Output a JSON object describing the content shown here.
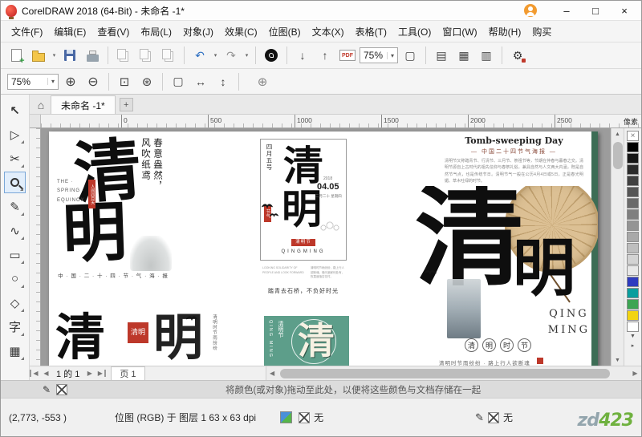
{
  "window": {
    "title": "CorelDRAW 2018 (64-Bit) - 未命名 -1*"
  },
  "icons": {
    "minimize": "–",
    "maximize": "□",
    "close": "×",
    "dropdown": "▾",
    "undo": "↶",
    "redo": "↷",
    "import": "↓",
    "export": "↑",
    "fullscreen": "▢",
    "rulers": "▤",
    "grid": "▦",
    "guides": "▥",
    "options": "⚙",
    "zoom_in": "⊕",
    "zoom_out": "⊖",
    "zoom_sel": "⊡",
    "zoom_all": "⊛",
    "zoom_page": "▢",
    "zoom_width": "↔",
    "zoom_height": "↕",
    "add_plus": "⊕",
    "home": "⌂",
    "tab_add": "+",
    "nav_first": "◀",
    "nav_prev": "◀",
    "nav_next": "▶",
    "nav_last": "▶",
    "scroll_left": "◀",
    "scroll_right": "▶",
    "scroll_up": "▲",
    "scroll_down": "▼",
    "none_x": "×",
    "pen": "✎",
    "flyout": "▸"
  },
  "menu": {
    "items": [
      "文件(F)",
      "编辑(E)",
      "查看(V)",
      "布局(L)",
      "对象(J)",
      "效果(C)",
      "位图(B)",
      "文本(X)",
      "表格(T)",
      "工具(O)",
      "窗口(W)",
      "帮助(H)",
      "购买"
    ]
  },
  "toolbar": {
    "zoom_value": "75%",
    "pdf_label": "PDF"
  },
  "propbar": {
    "zoom_value": "75%"
  },
  "doctabs": {
    "active": "未命名 -1*"
  },
  "ruler": {
    "ticks": [
      "0",
      "500",
      "1000",
      "1500",
      "2000",
      "2500"
    ],
    "unit": "像素"
  },
  "toolbox": {
    "tools": [
      {
        "name": "pick",
        "glyph": "↖"
      },
      {
        "name": "shape",
        "glyph": "▷"
      },
      {
        "name": "crop",
        "glyph": "✂"
      },
      {
        "name": "zoom",
        "glyph": ""
      },
      {
        "name": "freehand",
        "glyph": "✎"
      },
      {
        "name": "artistic-media",
        "glyph": "∿"
      },
      {
        "name": "rectangle",
        "glyph": "▭"
      },
      {
        "name": "ellipse",
        "glyph": "○"
      },
      {
        "name": "polygon",
        "glyph": "◇"
      },
      {
        "name": "text",
        "glyph": "字"
      },
      {
        "name": "table",
        "glyph": "▦"
      }
    ]
  },
  "palette": {
    "colors": [
      "#000000",
      "#161616",
      "#2b2b2b",
      "#404040",
      "#555555",
      "#6a6a6a",
      "#7f7f7f",
      "#949494",
      "#a9a9a9",
      "#bebebe",
      "#d3d3d3",
      "#e8e8e8",
      "#2e3bbf",
      "#0b9e9e",
      "#3da553",
      "#f2d411",
      "#ffffff"
    ]
  },
  "canvas": {
    "p1": {
      "line1": "春意盎然，",
      "line2": "风吹纸鸢",
      "big1": "清",
      "big2": "明",
      "en1": "THE ·",
      "en2": "SPRING ·",
      "en3": "EQUINOX",
      "seal": "人间四月天",
      "footer": "中 · 国 · 二 · 十 · 四 · 节 · 气 · 海 · 报"
    },
    "p2": {
      "corner": "四月五号",
      "big1": "清",
      "big2": "明",
      "seal": "节气",
      "year": "2018",
      "date": "04.05",
      "weekday": "二月二十 星期四",
      "festival": "清明节",
      "en": "QINGMING",
      "caption_en": "LOOKING SOLIDARITY OF PEOPLE AND LOOK FORWARD",
      "caption": "清明时节雨纷纷，路上行人欲断魂。借问酒家何处有，牧童遥指杏花村。",
      "quote": "踏青去石桥，不负好时光"
    },
    "p3": {
      "title": "Tomb-sweeping Day",
      "subtitle": "— 中国二十四节气海报 —",
      "body": "清明节又称踏青节、行清节、三月节、祭祖节等，节期在仲春与暮春之交。清明节源自上古时代的祖先信仰与春祭礼俗，兼具自然与人文两大内涵，既是自然节气点，也是传统节日。清明节气一般在公历4月4日或5日，正是春光明媚、草木吐绿的时节。"
    },
    "p4": {
      "big1": "清",
      "big2": "明",
      "en1": "QING",
      "en2": "MING",
      "circles": [
        "清",
        "明",
        "时",
        "节"
      ],
      "caption": "清明时节雨纷纷 · 路上行人欲断魂"
    },
    "p5": {
      "big1": "清",
      "big2": "明",
      "seal": "清明",
      "side": "清明时节雨纷纷"
    },
    "p6": {
      "en": "QING MING",
      "cn": "清明节",
      "big": "清"
    }
  },
  "pagenav": {
    "label": "1 的 1",
    "tab": "页 1"
  },
  "hint": {
    "text": "将颜色(或对象)拖动至此处，以便将这些颜色与文档存储在一起"
  },
  "statusbar": {
    "coords": "(2,773, -553 )",
    "object": "位图 (RGB) 于 图层 1  63 x 63 dpi",
    "fill_none": "无",
    "outline_none": "无"
  },
  "watermark": {
    "part1": "zd",
    "part2": "423"
  }
}
